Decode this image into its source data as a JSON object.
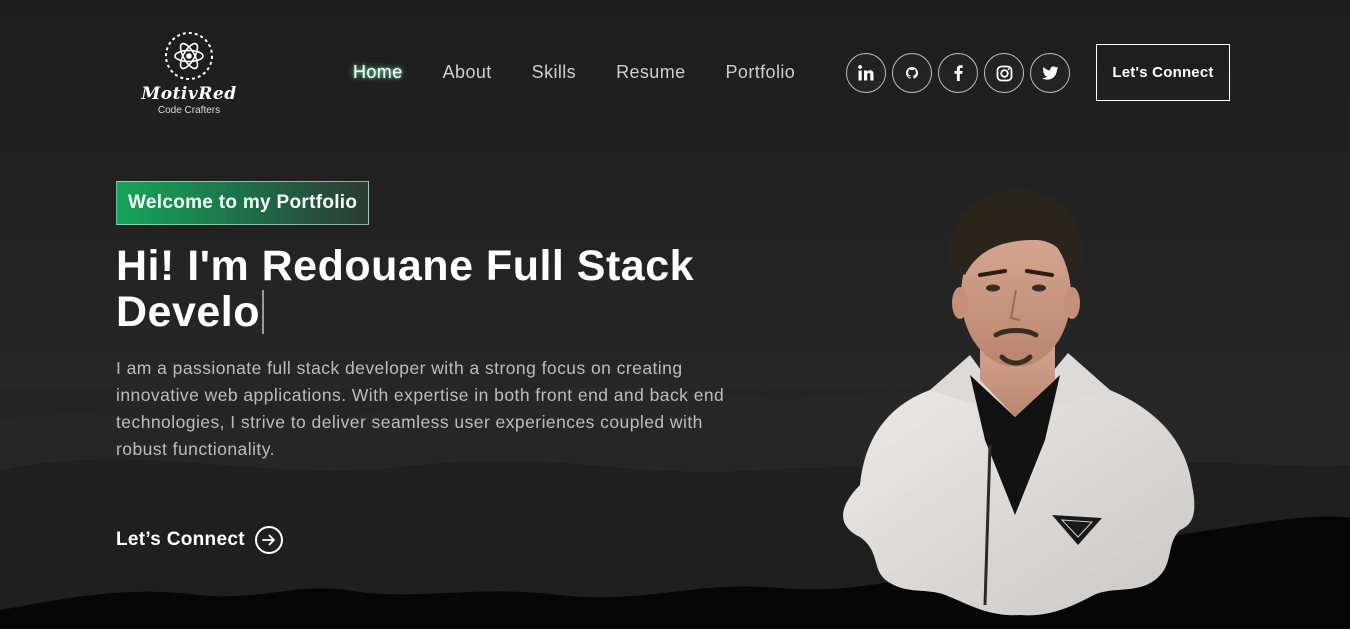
{
  "brand": {
    "name": "MotivRed",
    "tagline": "Code Crafters",
    "logo_icon": "atom-icon"
  },
  "nav": {
    "links": [
      {
        "label": "Home",
        "active": true
      },
      {
        "label": "About",
        "active": false
      },
      {
        "label": "Skills",
        "active": false
      },
      {
        "label": "Resume",
        "active": false
      },
      {
        "label": "Portfolio",
        "active": false
      }
    ],
    "social": [
      "linkedin-icon",
      "github-icon",
      "facebook-icon",
      "instagram-icon",
      "twitter-icon"
    ],
    "cta_label": "Let's Connect"
  },
  "hero": {
    "badge": "Welcome to my Portfolio",
    "headline_line1": "Hi! I'm Redouane Full Stack",
    "headline_line2": "Develo",
    "description": "I am a passionate full stack developer with a strong focus on creating innovative web applications. With expertise in both front end and back end technologies, I strive to deliver seamless user experiences coupled with robust functionality.",
    "connect_label": "Let’s Connect"
  },
  "colors": {
    "background": "#1c1c1c",
    "accent": "#16a55a",
    "active_glow": "#78ffbe"
  }
}
